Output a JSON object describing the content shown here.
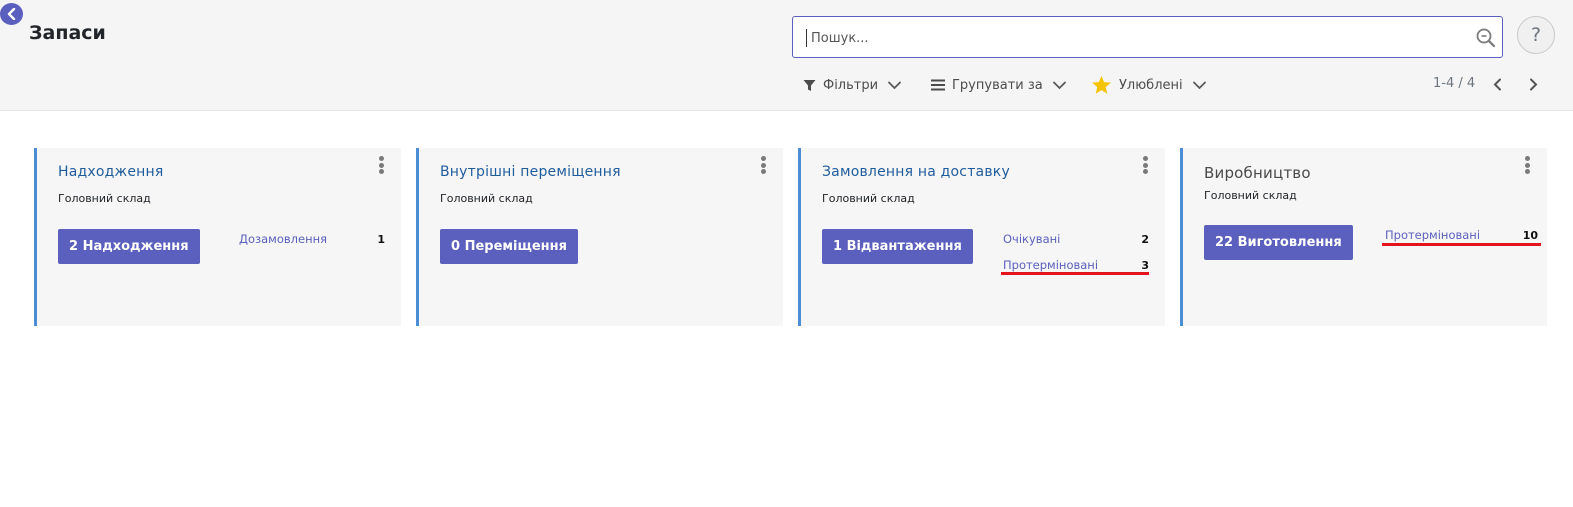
{
  "header": {
    "title": "Запаси"
  },
  "search": {
    "placeholder": "Пошук..."
  },
  "help": {
    "label": "?"
  },
  "filters": {
    "filters_label": "Фільтри",
    "group_by_label": "Групувати за",
    "favorites_label": "Улюблені"
  },
  "pager": {
    "value": "1-4 / 4"
  },
  "cards": [
    {
      "title": "Надходження",
      "warehouse": "Головний склад",
      "action": "2 Надходження",
      "stats": [
        {
          "label": "Дозамовлення",
          "count": "1"
        }
      ]
    },
    {
      "title": "Внутрішні переміщення",
      "warehouse": "Головний склад",
      "action": "0 Переміщення",
      "stats": []
    },
    {
      "title": "Замовлення на доставку",
      "warehouse": "Головний склад",
      "action": "1 Відвантаження",
      "stats": [
        {
          "label": "Очікувані",
          "count": "2"
        },
        {
          "label": "Протерміновані",
          "count": "3"
        }
      ]
    },
    {
      "title": "Виробництво",
      "warehouse": "Головний склад",
      "action": "22 Виготовлення",
      "stats": [
        {
          "label": "Протерміновані",
          "count": "10"
        }
      ]
    }
  ],
  "colors": {
    "accent": "#5b5fbd",
    "card_border": "#4b8ed6",
    "highlight": "#e3141c",
    "favorite_star": "#f5c400"
  }
}
